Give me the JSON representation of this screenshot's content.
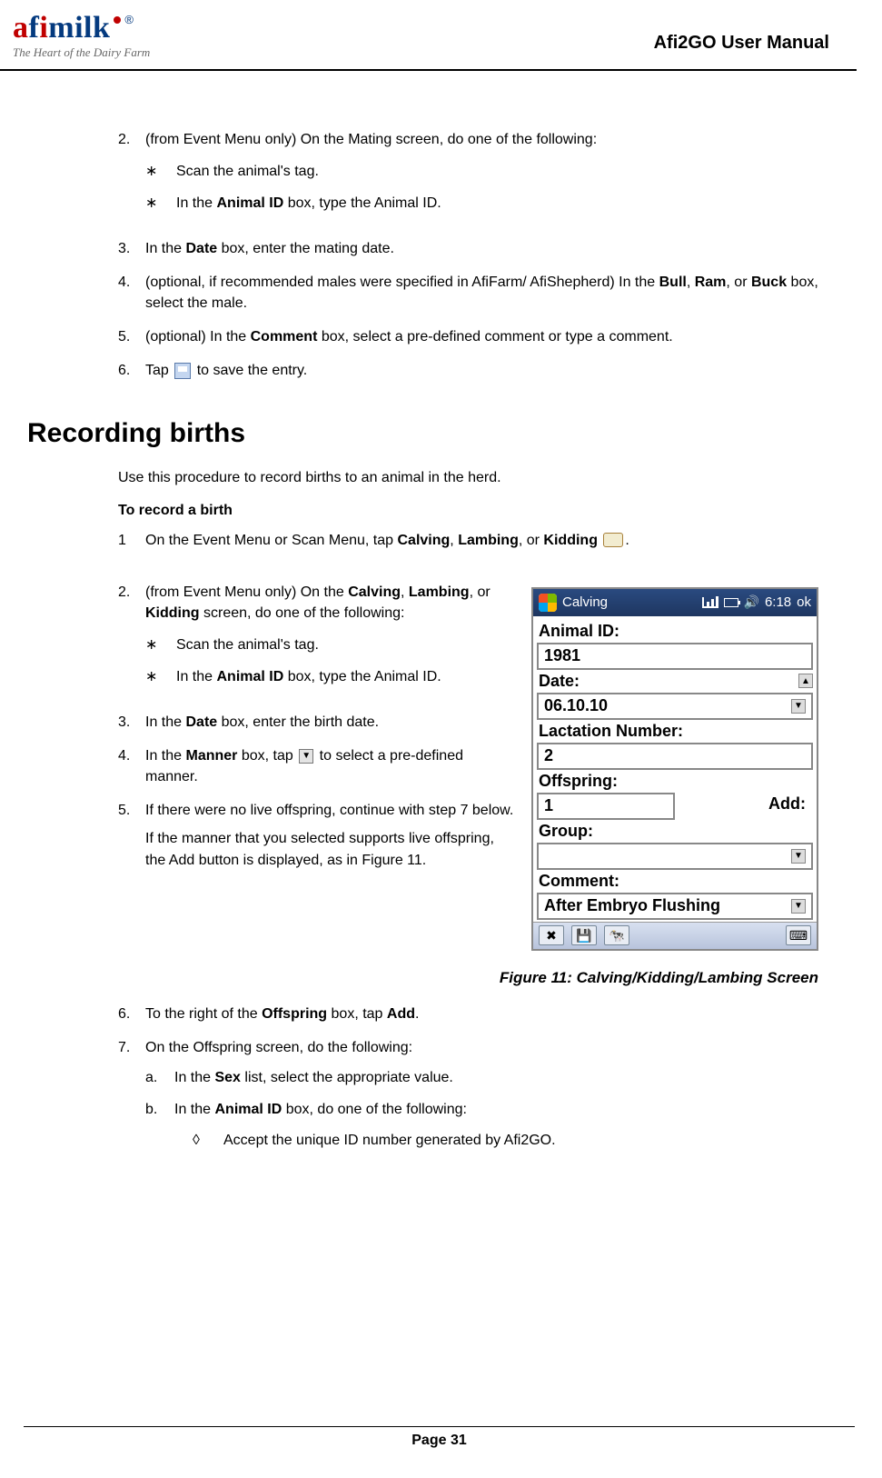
{
  "header": {
    "logo_name": "afimilk",
    "registered": "®",
    "tagline": "The Heart of the Dairy Farm",
    "manual_title": "Afi2GO User Manual"
  },
  "first_section": {
    "step2": {
      "num": "2.",
      "text_pre": "(from Event Menu only) On the Mating screen, do one of the following:",
      "b1": "Scan the animal's tag.",
      "b2_pre": "In the ",
      "b2_bold": "Animal ID",
      "b2_post": " box, type the Animal ID."
    },
    "step3": {
      "num": "3.",
      "pre": "In the ",
      "bold": "Date",
      "post": " box, enter the mating date."
    },
    "step4": {
      "num": "4.",
      "pre": "(optional, if recommended males were specified in AfiFarm/ AfiShepherd) In the ",
      "b1": "Bull",
      "c1": ", ",
      "b2": "Ram",
      "c2": ", or ",
      "b3": "Buck",
      "post": " box, select the male."
    },
    "step5": {
      "num": "5.",
      "pre": "(optional) In the ",
      "bold": "Comment",
      "post": " box, select a pre-defined comment or type a comment."
    },
    "step6": {
      "num": "6.",
      "pre": "Tap ",
      "post": " to save the entry."
    }
  },
  "section_heading": "Recording births",
  "intro": "Use this procedure to record births to an animal in the herd.",
  "subheading": "To record a birth",
  "rb": {
    "step1": {
      "num": "1",
      "pre": "On the Event Menu or Scan Menu, tap ",
      "b1": "Calving",
      "c1": ", ",
      "b2": "Lambing",
      "c2": ", or ",
      "b3": "Kidding",
      "post": " ",
      "dot": "."
    },
    "step2": {
      "num": "2.",
      "pre": "(from Event Menu only) On the ",
      "b1": "Calving",
      "c1": ", ",
      "b2": "Lambing",
      "c2": ", or ",
      "b3": "Kidding",
      "post": " screen, do one of the following:",
      "s1": "Scan the animal's tag.",
      "s2_pre": "In the ",
      "s2_bold": "Animal ID",
      "s2_post": " box, type the Animal ID."
    },
    "step3": {
      "num": "3.",
      "pre": "In the ",
      "bold": "Date",
      "post": " box, enter the birth date."
    },
    "step4": {
      "num": "4.",
      "pre": "In the ",
      "bold": "Manner",
      "post_pre": " box, tap ",
      "post": " to select a pre-defined manner."
    },
    "step5": {
      "num": "5.",
      "l1": "If there were no live offspring, continue with step 7 below.",
      "l2": "If the manner that you selected supports live offspring, the Add button is displayed, as in Figure 11."
    },
    "step6": {
      "num": "6.",
      "pre": "To the right of the ",
      "bold": "Offspring",
      "mid": " box, tap ",
      "bold2": "Add",
      "post": "."
    },
    "step7": {
      "num": "7.",
      "text": "On the Offspring screen, do the following:",
      "a_num": "a.",
      "a_pre": "In the ",
      "a_bold": "Sex",
      "a_post": " list, select the appropriate value.",
      "b_num": "b.",
      "b_pre": "In the ",
      "b_bold": "Animal ID",
      "b_post": " box, do one of the following:",
      "d1": "Accept the unique ID number generated by Afi2GO."
    }
  },
  "figure": {
    "titlebar": "Calving",
    "time": "6:18",
    "ok": "ok",
    "animal_id_label": "Animal ID:",
    "animal_id_value": "1981",
    "date_label": "Date:",
    "date_value": "06.10.10",
    "lact_label": "Lactation Number:",
    "lact_value": "2",
    "offspring_label": "Offspring:",
    "offspring_value": "1",
    "add_label": "Add:",
    "group_label": "Group:",
    "group_value": "",
    "comment_label": "Comment:",
    "comment_value": "After Embryo Flushing",
    "caption": "Figure 11: Calving/Kidding/Lambing Screen"
  },
  "footer": {
    "page": "Page 31"
  }
}
